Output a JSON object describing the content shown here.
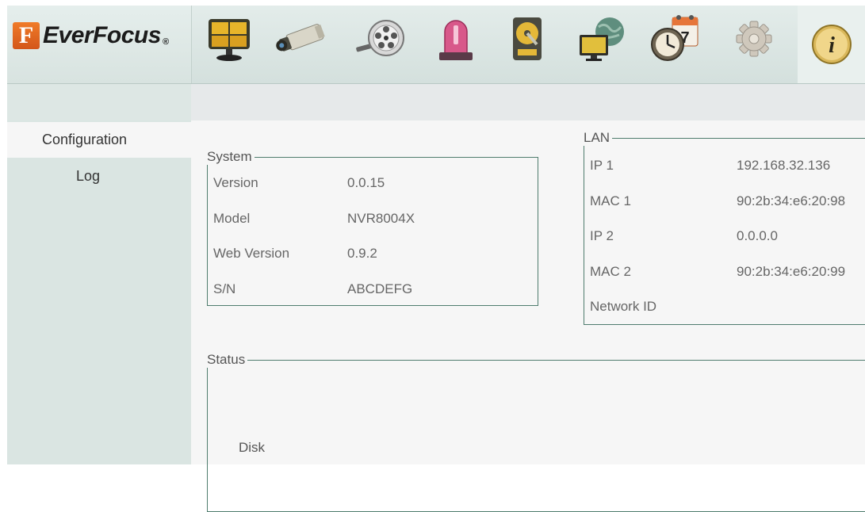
{
  "brand": {
    "name": "EverFocus",
    "mark_letter": "F",
    "reg": "®",
    "accent_color": "#e8682a"
  },
  "nav": {
    "items": [
      {
        "icon": "monitor-grid-icon"
      },
      {
        "icon": "camera-icon"
      },
      {
        "icon": "playback-reel-icon"
      },
      {
        "icon": "alarm-light-icon"
      },
      {
        "icon": "hard-disk-icon"
      },
      {
        "icon": "network-globe-icon"
      },
      {
        "icon": "schedule-clock-icon",
        "badge": "7"
      },
      {
        "icon": "gear-icon"
      },
      {
        "icon": "info-icon",
        "glyph": "i",
        "active": true
      }
    ]
  },
  "sidebar": {
    "items": [
      {
        "label": "Configuration",
        "selected": true
      },
      {
        "label": "Log",
        "selected": false
      }
    ]
  },
  "system": {
    "legend": "System",
    "rows": [
      {
        "label": "Version",
        "value": "0.0.15"
      },
      {
        "label": "Model",
        "value": "NVR8004X"
      },
      {
        "label": "Web Version",
        "value": "0.9.2"
      },
      {
        "label": "S/N",
        "value": "ABCDEFG"
      }
    ]
  },
  "lan": {
    "legend": "LAN",
    "rows": [
      {
        "label": "IP 1",
        "value": "192.168.32.136"
      },
      {
        "label": "MAC 1",
        "value": "90:2b:34:e6:20:98"
      },
      {
        "label": "IP 2",
        "value": "0.0.0.0"
      },
      {
        "label": "MAC 2",
        "value": "90:2b:34:e6:20:99"
      },
      {
        "label": "Network ID",
        "value": ""
      }
    ]
  },
  "status": {
    "legend": "Status",
    "disk_label": "Disk"
  }
}
